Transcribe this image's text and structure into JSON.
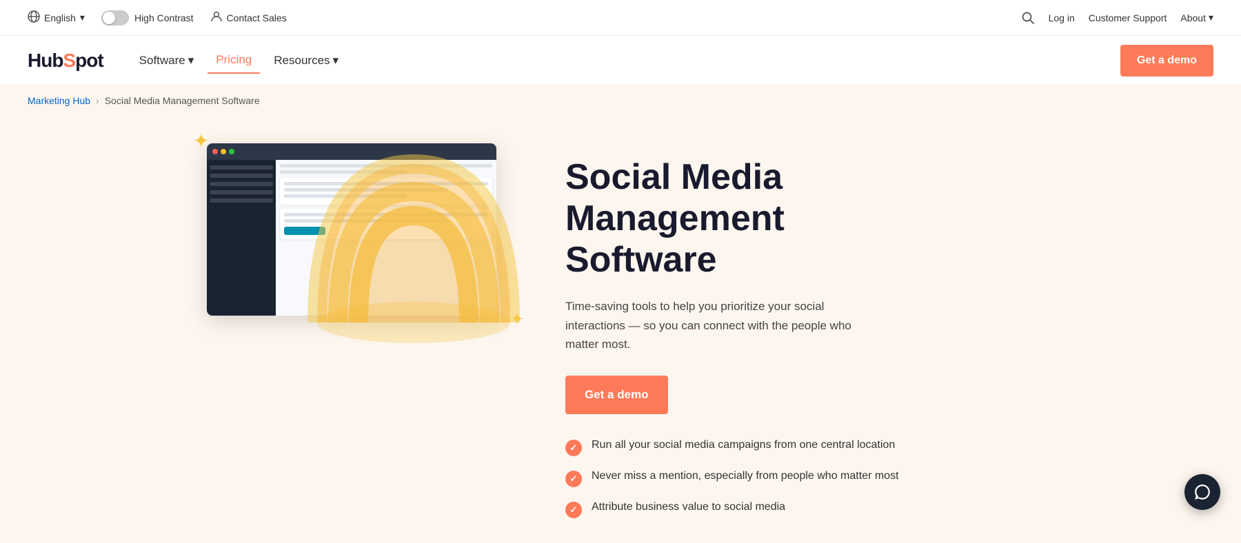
{
  "topbar": {
    "lang": "English",
    "high_contrast": "High Contrast",
    "contact_sales": "Contact Sales",
    "login": "Log in",
    "customer_support": "Customer Support",
    "about": "About"
  },
  "nav": {
    "logo": "HubSpot",
    "items": [
      {
        "label": "Software",
        "active": false,
        "has_dropdown": true
      },
      {
        "label": "Pricing",
        "active": true,
        "has_dropdown": false
      },
      {
        "label": "Resources",
        "active": false,
        "has_dropdown": true
      }
    ],
    "cta": "Get a demo"
  },
  "breadcrumb": {
    "parent": "Marketing Hub",
    "current": "Social Media Management Software"
  },
  "hero": {
    "title": "Social Media Management Software",
    "subtitle": "Time-saving tools to help you prioritize your social interactions — so you can connect with the people who matter most.",
    "cta": "Get a demo",
    "features": [
      "Run all your social media campaigns from one central location",
      "Never miss a mention, especially from people who matter most",
      "Attribute business value to social media"
    ]
  }
}
